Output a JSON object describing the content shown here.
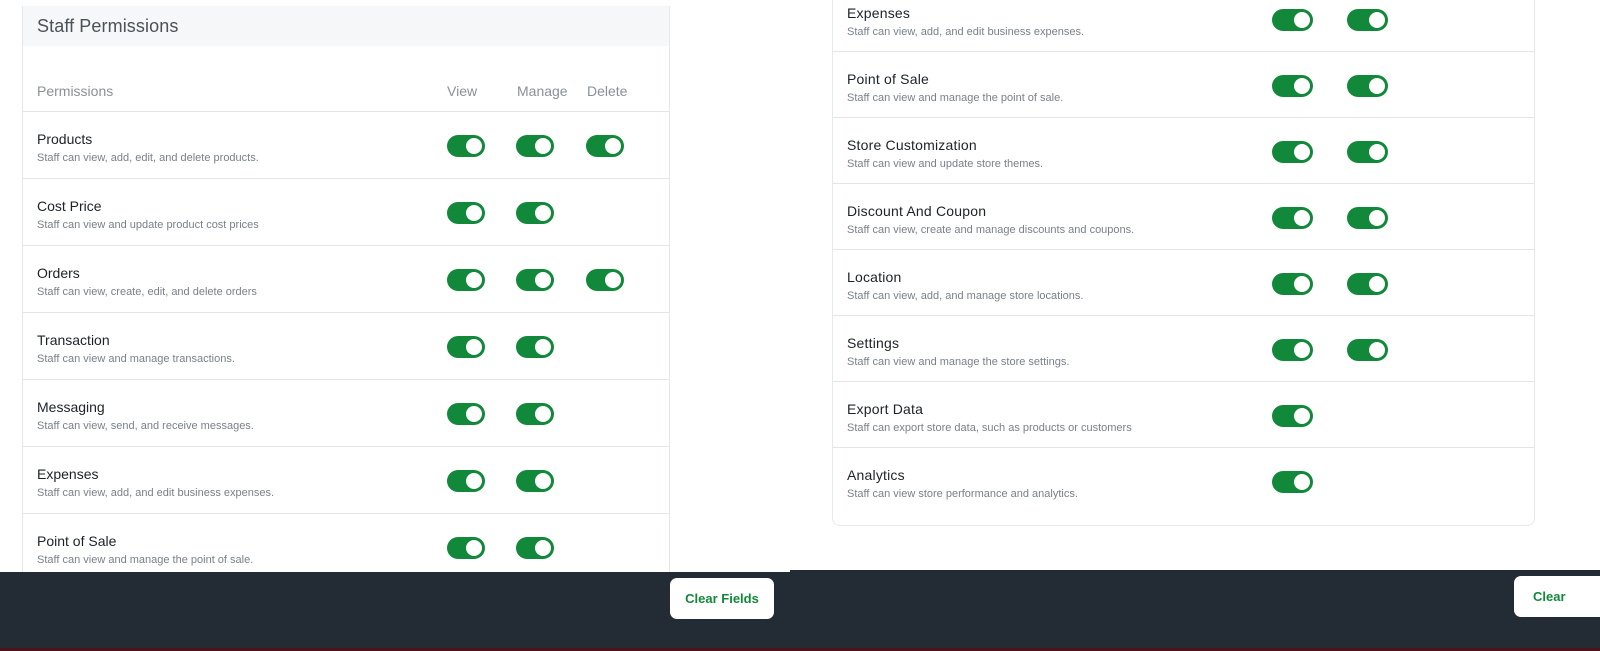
{
  "left": {
    "title": "Staff Permissions",
    "headers": {
      "permissions": "Permissions",
      "view": "View",
      "manage": "Manage",
      "delete": "Delete"
    },
    "rows": [
      {
        "title": "Products",
        "desc": "Staff can view, add, edit, and delete products.",
        "view": true,
        "manage": true,
        "delete": true
      },
      {
        "title": "Cost Price",
        "desc": "Staff can view and update product cost prices",
        "view": true,
        "manage": true,
        "delete": false
      },
      {
        "title": "Orders",
        "desc": "Staff can view, create, edit, and delete orders",
        "view": true,
        "manage": true,
        "delete": true
      },
      {
        "title": "Transaction",
        "desc": "Staff can view and manage transactions.",
        "view": true,
        "manage": true,
        "delete": false
      },
      {
        "title": "Messaging",
        "desc": "Staff can view, send, and receive messages.",
        "view": true,
        "manage": true,
        "delete": false
      },
      {
        "title": "Expenses",
        "desc": "Staff can view, add, and edit business expenses.",
        "view": true,
        "manage": true,
        "delete": false
      },
      {
        "title": "Point of Sale",
        "desc": "Staff can view and manage the point of sale.",
        "view": true,
        "manage": true,
        "delete": false
      }
    ]
  },
  "right": {
    "rows": [
      {
        "title": "Expenses",
        "desc": "Staff can view, add, and edit business expenses.",
        "view": true,
        "manage": true
      },
      {
        "title": "Point of Sale",
        "desc": "Staff can view and manage the point of sale.",
        "view": true,
        "manage": true
      },
      {
        "title": "Store Customization",
        "desc": "Staff can view and update store themes.",
        "view": true,
        "manage": true
      },
      {
        "title": "Discount And Coupon",
        "desc": "Staff can view, create and manage discounts and coupons.",
        "view": true,
        "manage": true
      },
      {
        "title": "Location",
        "desc": "Staff can view, add, and manage store locations.",
        "view": true,
        "manage": true
      },
      {
        "title": "Settings",
        "desc": "Staff can view and manage the store settings.",
        "view": true,
        "manage": true
      },
      {
        "title": "Export Data",
        "desc": "Staff can export store data, such as products or customers",
        "view": true,
        "manage": false
      },
      {
        "title": "Analytics",
        "desc": "Staff can view store performance and analytics.",
        "view": true,
        "manage": false
      }
    ]
  },
  "footer": {
    "clear_left": "Clear Fields",
    "clear_right": "Clear"
  },
  "colors": {
    "toggle_on": "#12893a",
    "footer_bg": "#232b35",
    "accent_text": "#12893a"
  }
}
